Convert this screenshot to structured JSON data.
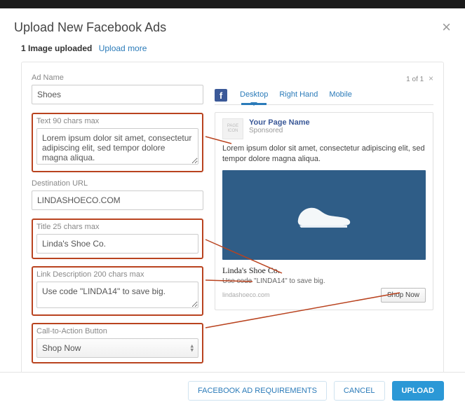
{
  "modal": {
    "title": "Upload New Facebook Ads",
    "uploaded_count": "1 Image uploaded",
    "upload_more": "Upload more",
    "preview_counter": "1 of 1"
  },
  "form": {
    "ad_name_label": "Ad Name",
    "ad_name_value": "Shoes",
    "text_label": "Text 90 chars max",
    "text_value": "Lorem ipsum dolor sit amet, consectetur adipiscing elit, sed tempor dolore magna aliqua.",
    "dest_url_label": "Destination URL",
    "dest_url_value": "LINDASHOECO.COM",
    "title_label": "Title 25 chars max",
    "title_value": "Linda's Shoe Co.",
    "link_desc_label": "Link Description 200 chars max",
    "link_desc_value": "Use code \"LINDA14\" to save big.",
    "cta_label": "Call-to-Action Button",
    "cta_value": "Shop Now"
  },
  "tabs": {
    "desktop": "Desktop",
    "right_hand": "Right Hand",
    "mobile": "Mobile"
  },
  "preview": {
    "page_icon_text": "PAGE ICON",
    "page_name": "Your Page Name",
    "sponsored": "Sponsored",
    "body_text": "Lorem ipsum dolor sit amet, consectetur adipiscing elit, sed tempor dolore magna aliqua.",
    "title": "Linda's Shoe Co.",
    "description": "Use code \"LINDA14\" to save big.",
    "display_url": "lindashoeco.com",
    "cta": "Shop Now"
  },
  "footer": {
    "requirements": "FACEBOOK AD REQUIREMENTS",
    "cancel": "CANCEL",
    "upload": "UPLOAD"
  }
}
